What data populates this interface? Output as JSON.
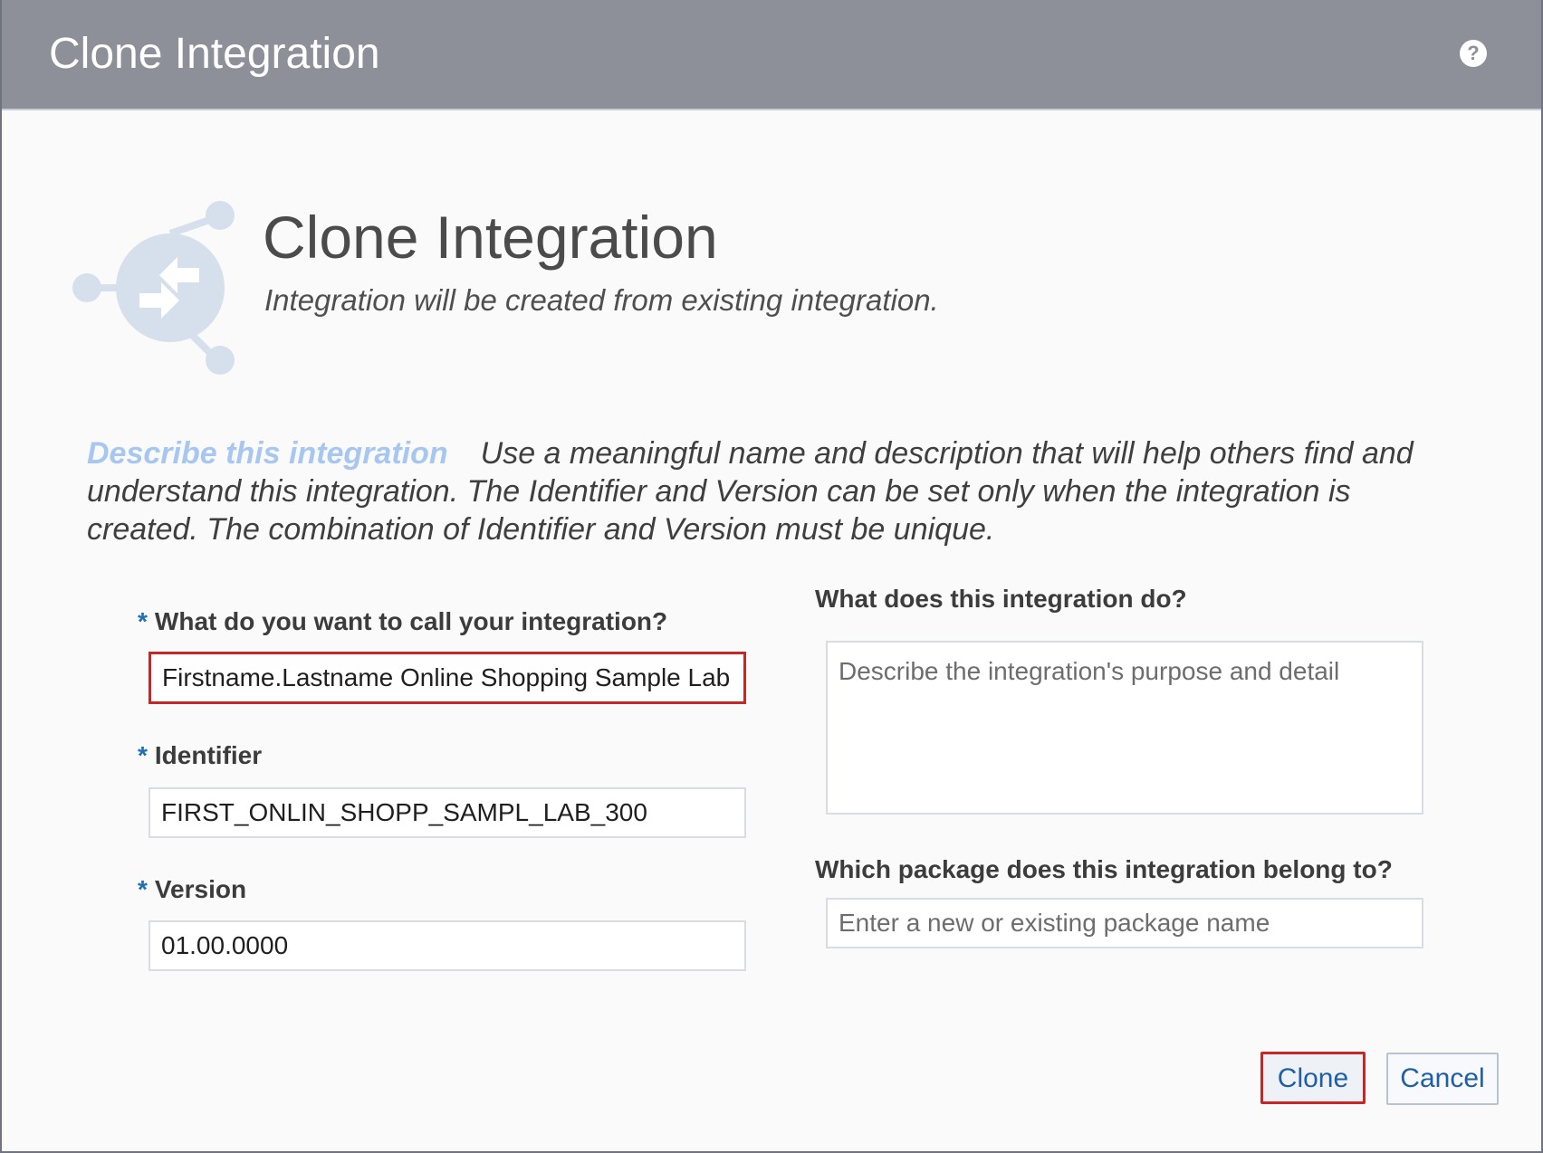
{
  "dialog": {
    "title": "Clone Integration",
    "help_icon": "?"
  },
  "hero": {
    "title": "Clone Integration",
    "subtitle": "Integration will be created from existing integration.",
    "icon": "integration-clone-icon"
  },
  "description": {
    "heading": "Describe this integration",
    "text": "Use a meaningful name and description that will help others find and understand this integration. The Identifier and Version can be set only when the integration is created. The combination of Identifier and Version must be unique."
  },
  "form": {
    "required_mark": "*",
    "name": {
      "label": "What do you want to call your integration?",
      "value": "Firstname.Lastname Online Shopping Sample Lab"
    },
    "identifier": {
      "label": "Identifier",
      "value": "FIRST_ONLIN_SHOPP_SAMPL_LAB_300"
    },
    "version": {
      "label": "Version",
      "value": "01.00.0000"
    },
    "description": {
      "label": "What does this integration do?",
      "placeholder": "Describe the integration's purpose and detail"
    },
    "package": {
      "label": "Which package does this integration belong to?",
      "placeholder": "Enter a new or existing package name"
    }
  },
  "buttons": {
    "clone": "Clone",
    "cancel": "Cancel"
  },
  "colors": {
    "titlebar": "#8e9099",
    "accent": "#1f5fa8",
    "highlight": "#c62828",
    "desc_heading": "#a8c7f0"
  }
}
